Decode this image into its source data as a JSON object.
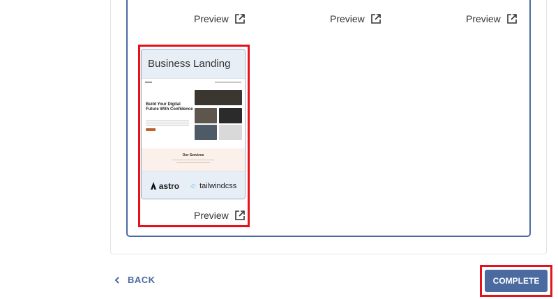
{
  "templates_row": [
    {
      "preview_label": "Preview"
    },
    {
      "preview_label": "Preview"
    },
    {
      "preview_label": "Preview"
    }
  ],
  "business_template": {
    "title": "Business Landing",
    "thumbnail": {
      "hero_heading": "Build Your Digital Future With Confidence",
      "services_heading": "Our Services"
    },
    "tech": [
      "astro",
      "tailwindcss"
    ],
    "preview_label": "Preview"
  },
  "footer": {
    "back_label": "BACK",
    "complete_label": "COMPLETE"
  },
  "colors": {
    "accent": "#4a6aa0",
    "highlight": "#e5121b"
  }
}
